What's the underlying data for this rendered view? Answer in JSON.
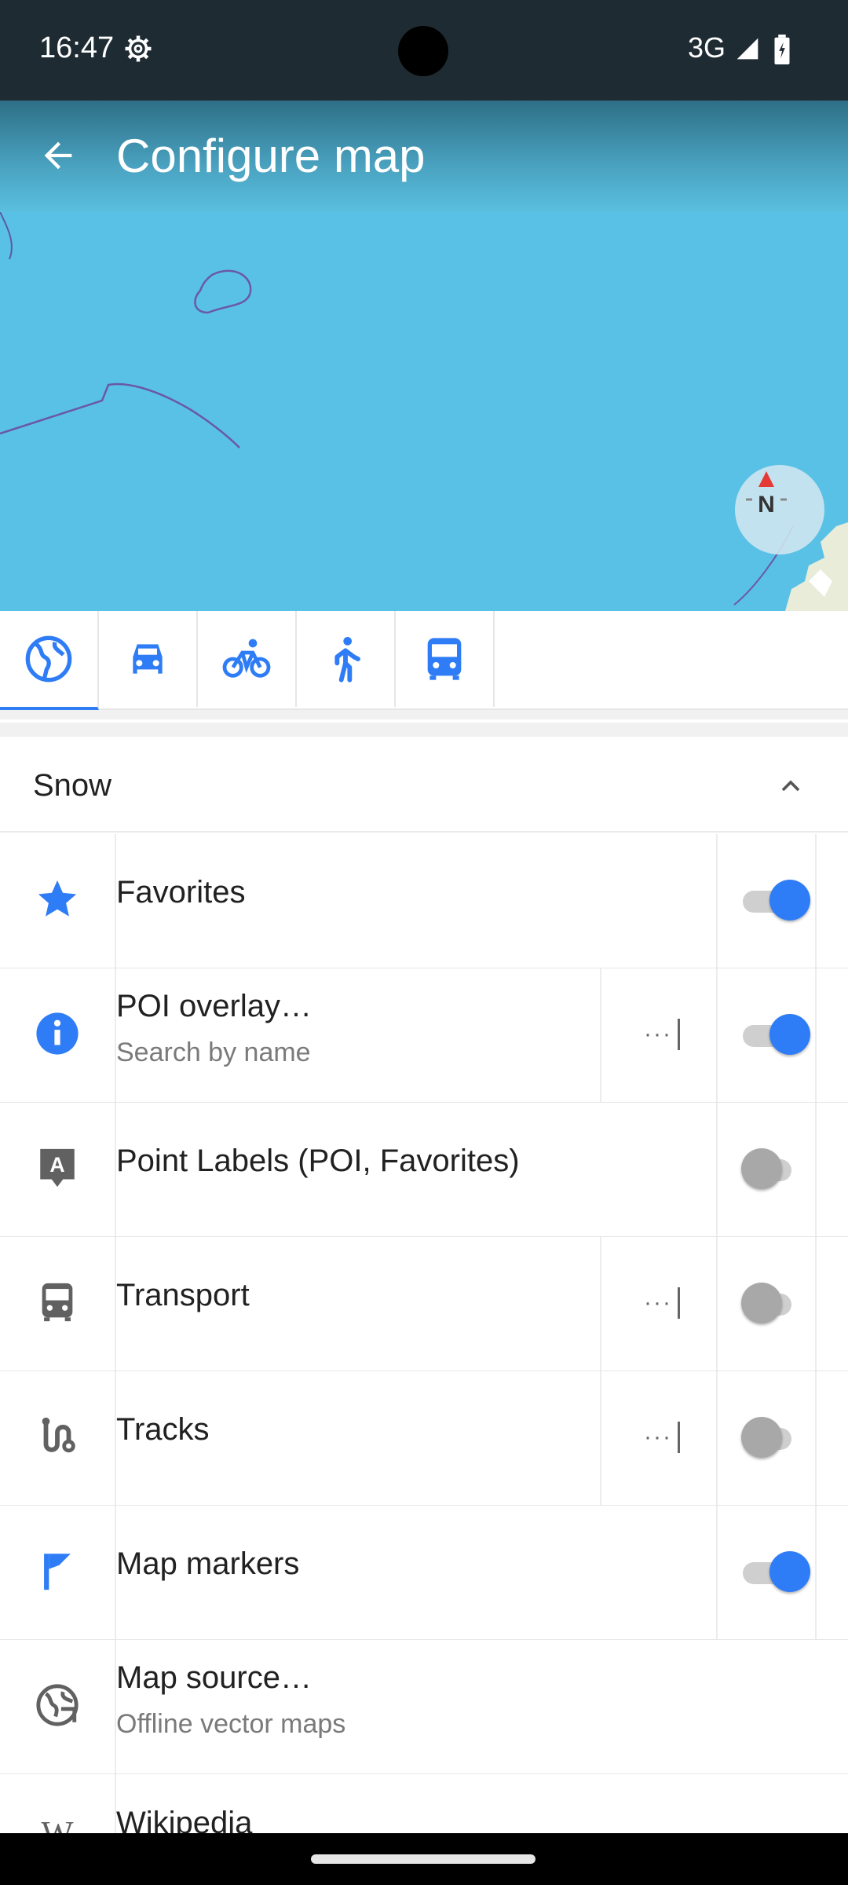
{
  "status_bar": {
    "time": "16:47",
    "network": "3G",
    "icons": [
      "gear-icon",
      "signal-icon",
      "battery-icon"
    ]
  },
  "header": {
    "title": "Configure map",
    "back_icon": "arrow-back-icon"
  },
  "map": {
    "compass_label": "N"
  },
  "profiles": [
    {
      "name": "browse-map",
      "icon": "globe-icon",
      "selected": true
    },
    {
      "name": "car",
      "icon": "car-icon",
      "selected": false
    },
    {
      "name": "bicycle",
      "icon": "bicycle-icon",
      "selected": false
    },
    {
      "name": "pedestrian",
      "icon": "pedestrian-icon",
      "selected": false
    },
    {
      "name": "public-transport",
      "icon": "bus-icon",
      "selected": false
    }
  ],
  "section": {
    "title": "Snow"
  },
  "rows": [
    {
      "title": "Favorites",
      "icon": "star-icon",
      "toggle": true,
      "has_more": false
    },
    {
      "title": "POI overlay…",
      "subtitle": "Search by name",
      "icon": "info-icon",
      "toggle": true,
      "has_more": true
    },
    {
      "title": "Point Labels (POI, Favorites)",
      "icon": "label-icon",
      "toggle": false,
      "has_more": false
    },
    {
      "title": "Transport",
      "icon": "bus-icon",
      "toggle": false,
      "has_more": true
    },
    {
      "title": "Tracks",
      "icon": "track-icon",
      "toggle": false,
      "has_more": true
    },
    {
      "title": "Map markers",
      "icon": "flag-icon",
      "toggle": true,
      "has_more": false
    },
    {
      "title": "Map source…",
      "subtitle": "Offline vector maps",
      "icon": "map-source-icon",
      "has_more": false
    },
    {
      "title": "Wikipedia",
      "icon": "wikipedia-icon"
    }
  ],
  "colors": {
    "accent": "#2f7df6",
    "status_bar": "#1f2b33",
    "map_water": "#5ac1e6"
  }
}
